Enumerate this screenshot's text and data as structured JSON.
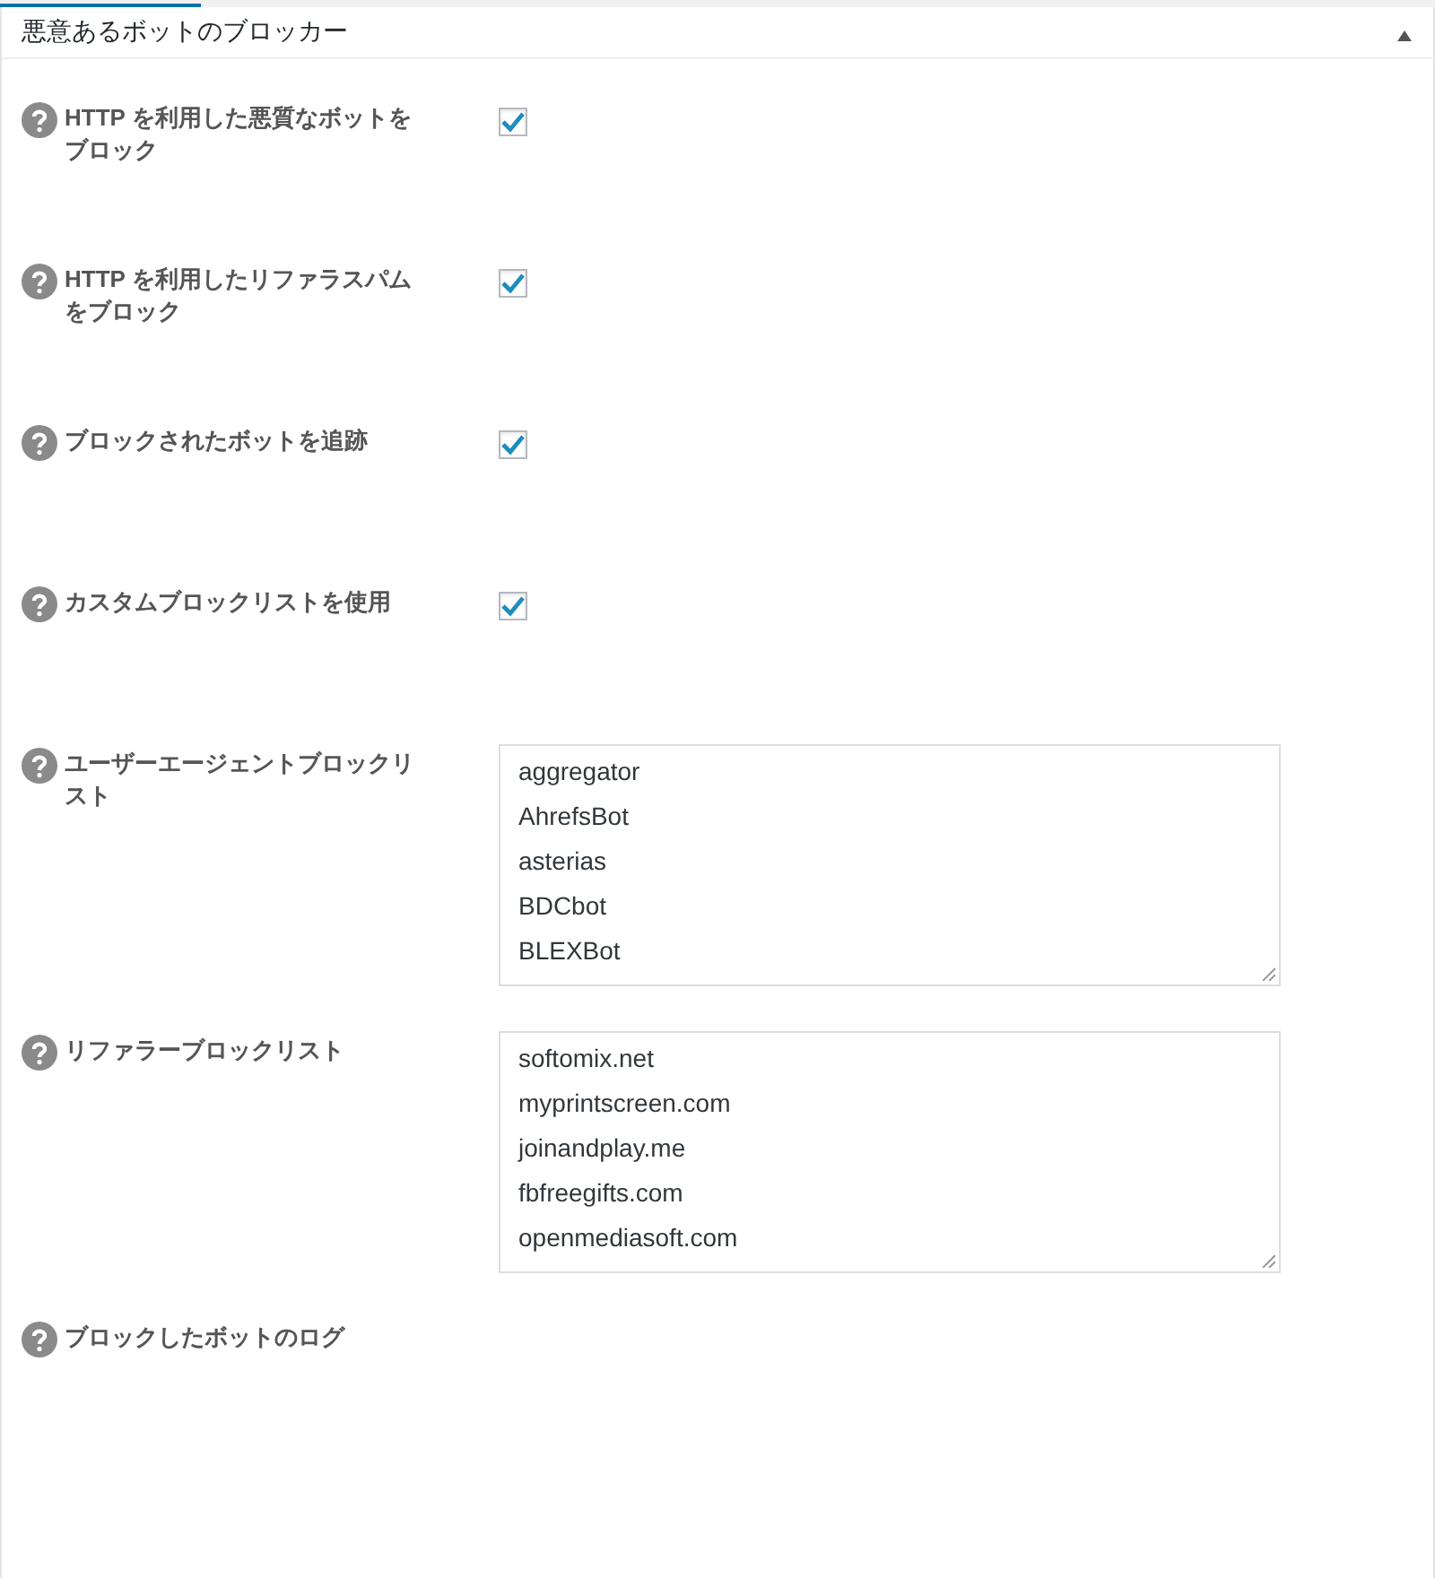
{
  "panel": {
    "title": "悪意あるボットのブロッカー",
    "expanded": true
  },
  "settings": [
    {
      "kind": "checkbox",
      "label": "HTTP を利用した悪質なボットをブロック",
      "checked": true
    },
    {
      "kind": "checkbox",
      "label": "HTTP を利用したリファラスパムをブロック",
      "checked": true
    },
    {
      "kind": "checkbox",
      "label": "ブロックされたボットを追跡",
      "checked": true
    },
    {
      "kind": "checkbox",
      "label": "カスタムブロックリストを使用",
      "checked": true
    },
    {
      "kind": "list",
      "label": "ユーザーエージェントブロックリスト",
      "lines": [
        "aggregator",
        "AhrefsBot",
        "asterias",
        "BDCbot",
        "BLEXBot"
      ]
    },
    {
      "kind": "list",
      "label": "リファラーブロックリスト",
      "lines": [
        "softomix.net",
        "myprintscreen.com",
        "joinandplay.me",
        "fbfreegifts.com",
        "openmediasoft.com"
      ]
    },
    {
      "kind": "log",
      "label": "ブロックしたボットのログ"
    }
  ]
}
